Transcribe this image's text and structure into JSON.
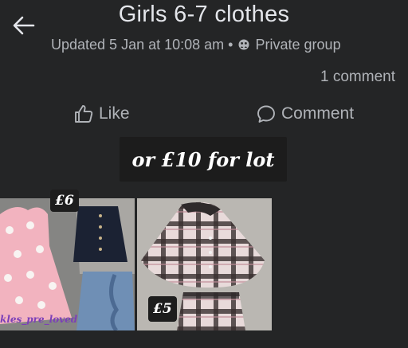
{
  "header": {
    "title": "Girls 6-7 clothes",
    "updated": "Updated 5 Jan at 10:08 am",
    "separator": "•",
    "privacy": "Private group"
  },
  "stats": {
    "comments": "1 comment"
  },
  "actions": {
    "like": "Like",
    "comment": "Comment"
  },
  "post": {
    "lot_text": "or £10 for lot",
    "photos": [
      {
        "price": "£6",
        "watermark": "kles_pre_loved"
      },
      {
        "price": "£5"
      }
    ]
  },
  "colors": {
    "background": "#242526",
    "text": "#b0b3b8",
    "title": "#e4e6eb",
    "caption_bg": "#1c1c1c"
  },
  "icons": [
    "back-arrow-icon",
    "group-icon",
    "thumbs-up-icon",
    "comment-bubble-icon"
  ]
}
